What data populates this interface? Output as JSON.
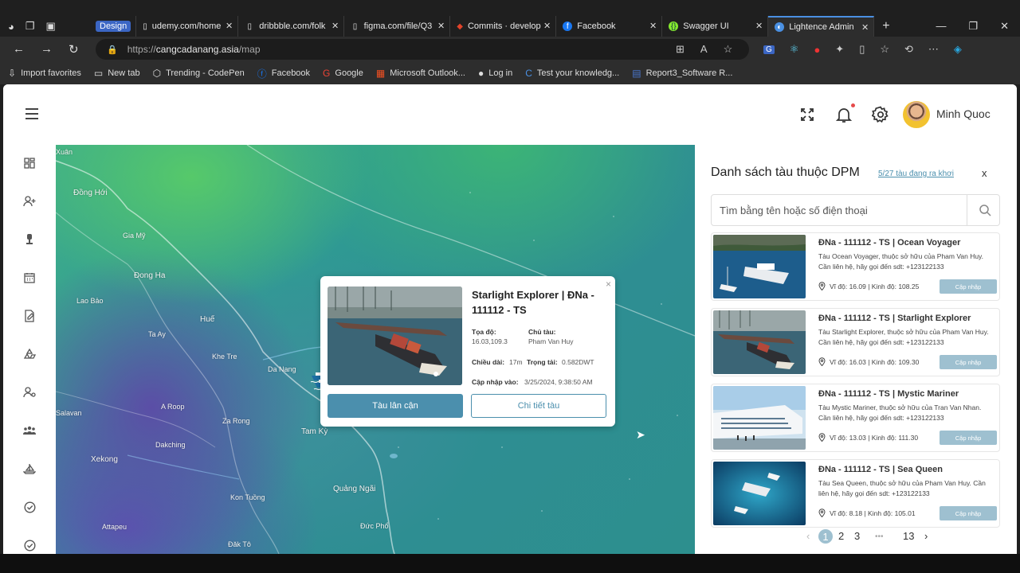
{
  "browser": {
    "tab_group": "Design",
    "tabs": [
      {
        "label": "udemy.com/home",
        "icon": "page-icon"
      },
      {
        "label": "dribbble.com/folk",
        "icon": "page-icon"
      },
      {
        "label": "figma.com/file/Q3",
        "icon": "page-icon"
      },
      {
        "label": "Commits · develop",
        "icon": "gitlab-icon"
      },
      {
        "label": "Facebook",
        "icon": "facebook-icon"
      },
      {
        "label": "Swagger UI",
        "icon": "swagger-icon"
      },
      {
        "label": "Lightence Admin",
        "icon": "lightence-icon",
        "active": true
      }
    ],
    "url_prefix": "https://",
    "url_host": "cangcadanang.asia",
    "url_path": "/map",
    "bookmarks": [
      {
        "label": "Import favorites",
        "icon": "import-icon"
      },
      {
        "label": "New tab",
        "icon": "newtab-icon"
      },
      {
        "label": "Trending - CodePen",
        "icon": "codepen-icon"
      },
      {
        "label": "Facebook",
        "icon": "facebook-icon"
      },
      {
        "label": "Google",
        "icon": "google-icon"
      },
      {
        "label": "Microsoft Outlook...",
        "icon": "microsoft-icon"
      },
      {
        "label": "Log in",
        "icon": "github-icon"
      },
      {
        "label": "Test your knowledg...",
        "icon": "c-icon"
      },
      {
        "label": "Report3_Software R...",
        "icon": "doc-icon"
      }
    ]
  },
  "header": {
    "user_name": "Minh Quoc"
  },
  "map": {
    "labels": [
      {
        "text": "Xuân"
      },
      {
        "text": "Đồng Hới"
      },
      {
        "text": "Gia Mỹ"
      },
      {
        "text": "Đong Ha"
      },
      {
        "text": "Lao Bảo"
      },
      {
        "text": "Huế"
      },
      {
        "text": "Ta Ay"
      },
      {
        "text": "Khe Tre"
      },
      {
        "text": "Da Nang"
      },
      {
        "text": "A Roop"
      },
      {
        "text": "Salavan"
      },
      {
        "text": "Za Rong"
      },
      {
        "text": "Tam Kỳ"
      },
      {
        "text": "Dakching"
      },
      {
        "text": "Xekong"
      },
      {
        "text": "Quảng Ngãi"
      },
      {
        "text": "Kon Tuồng"
      },
      {
        "text": "Attapeu"
      },
      {
        "text": "Đức Phổ"
      },
      {
        "text": "Đăk Tô"
      }
    ]
  },
  "popup": {
    "title": "Starlight Explorer | ĐNa - 111112 - TS",
    "coord_label": "Tọa độ:",
    "coord_value": "16.03,109.3",
    "owner_label": "Chủ tàu:",
    "owner_value": "Pham Van Huy",
    "length_label": "Chiều dài:",
    "length_value": "17m",
    "tonnage_label": "Trọng tải:",
    "tonnage_value": "0.582DWT",
    "updated_label": "Cập nhập vào:",
    "updated_value": "3/25/2024, 9:38:50 AM",
    "close": "×",
    "btn_nearby": "Tàu lân cận",
    "btn_detail": "Chi tiết tàu"
  },
  "panel": {
    "title": "Danh sách tàu thuộc DPM",
    "link": "5/27 tàu đang ra khơi",
    "close": "x",
    "search_placeholder": "Tìm bằng tên hoặc số điện thoại",
    "cards": [
      {
        "title": "ĐNa - 111112 - TS | Ocean Voyager",
        "desc": "Tàu Ocean Voyager, thuộc sở hữu của Pham Van Huy. Cần liên hệ, hãy gọi đến sdt: +123122133",
        "coord": "Vĩ độ: 16.09 | Kinh độ: 108.25",
        "btn": "Cập nhập"
      },
      {
        "title": "ĐNa - 111112 - TS | Starlight Explorer",
        "desc": "Tàu Starlight Explorer, thuộc sở hữu của Pham Van Huy. Cần liên hệ, hãy gọi đến sdt: +123122133",
        "coord": "Vĩ độ: 16.03 | Kinh độ: 109.30",
        "btn": "Cập nhập"
      },
      {
        "title": "ĐNa - 111112 - TS | Mystic Mariner",
        "desc": "Tàu Mystic Mariner, thuộc sở hữu của Tran Van Nhan. Cần liên hệ, hãy gọi đến sdt: +123122133",
        "coord": "Vĩ độ: 13.03 | Kinh độ: 111.30",
        "btn": "Cập nhập"
      },
      {
        "title": "ĐNa - 111112 - TS | Sea Queen",
        "desc": "Tàu Sea Queen, thuộc sở hữu của Pham Van Huy. Cần liên hệ, hãy gọi đến sdt: +123122133",
        "coord": "Vĩ độ: 8.18 | Kinh độ: 105.01",
        "btn": "Cập nhập"
      }
    ],
    "pagination": {
      "prev": "‹",
      "pages": [
        "1",
        "2",
        "3"
      ],
      "ellipsis": "•••",
      "last": "13",
      "next": "›",
      "current": "1"
    }
  }
}
